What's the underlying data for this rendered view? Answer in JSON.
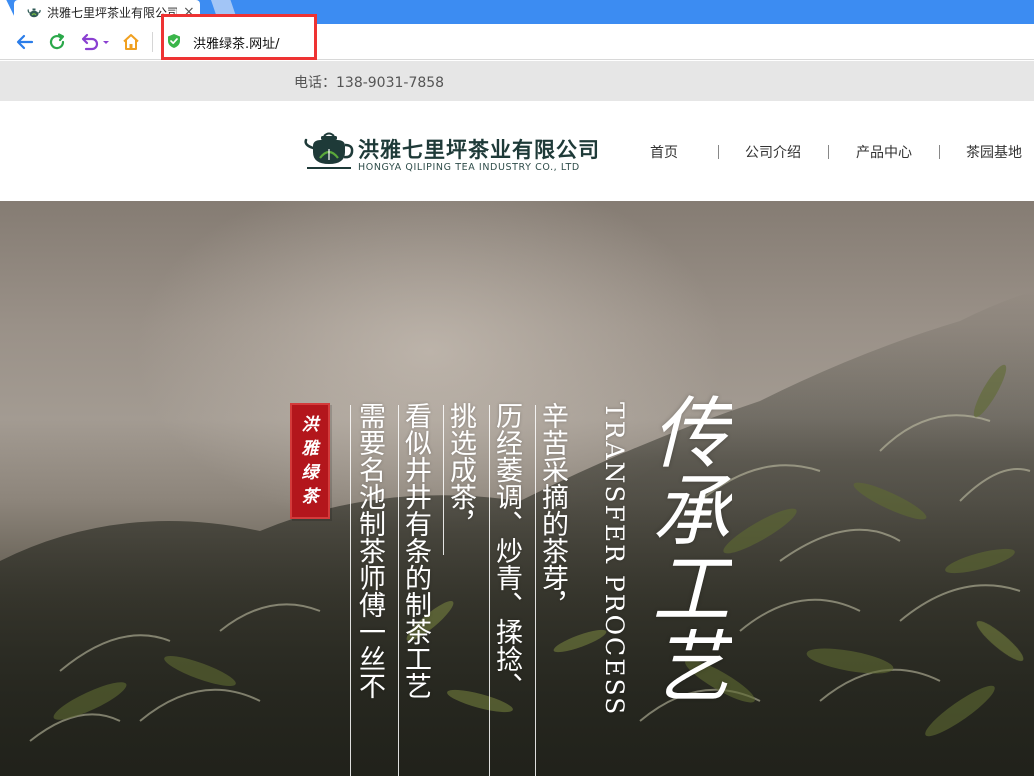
{
  "browser": {
    "tab_title": "洪雅七里坪茶业有限公司",
    "tab_close_glyph": "×",
    "address": "洪雅绿茶.网址/",
    "icons": {
      "back": "back-arrow-icon",
      "refresh": "refresh-icon",
      "undo": "undo-dropdown-icon",
      "home": "home-icon",
      "secure": "shield-check-icon"
    },
    "colors": {
      "tabstrip": "#3c8cf2",
      "highlight": "#ee3333",
      "back": "#2b7de9",
      "refresh": "#2aa84a",
      "undo": "#8a3fd1",
      "home": "#f0a020"
    }
  },
  "site": {
    "phone": "电话：138-9031-7858",
    "logo": {
      "name": "洪雅七里坪茶业有限公司",
      "english": "HONGYA QILIPING TEA INDUSTRY CO., LTD",
      "icon": "teapot-logo-icon"
    },
    "nav": [
      {
        "label": "首页"
      },
      {
        "label": "公司介绍"
      },
      {
        "label": "产品中心"
      },
      {
        "label": "茶园基地"
      }
    ],
    "colors": {
      "topbar": "#e6e6e6",
      "logo": "#1e3a38",
      "seal": "#b3161c"
    }
  },
  "hero": {
    "seal_chars": [
      "洪",
      "雅",
      "绿",
      "茶"
    ],
    "columns": [
      "辛苦采摘的茶芽，",
      "历经萎调、炒青、揉捻、",
      "挑选成茶，",
      "看似井井有条的制茶工艺",
      "需要名池制茶师傅一丝不"
    ],
    "english_vertical": "TRANSFER PROCESS",
    "calligraphy": "传承工艺"
  }
}
